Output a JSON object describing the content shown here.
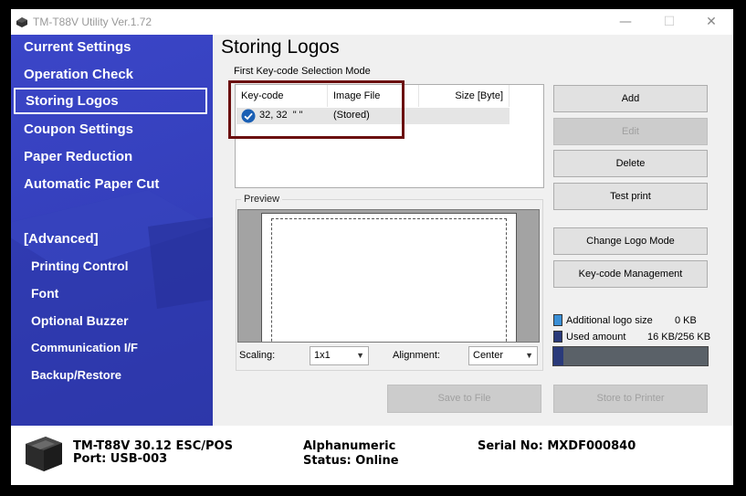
{
  "window": {
    "title": "TM-T88V Utility Ver.1.72",
    "minimize": "—",
    "maximize": "☐",
    "close": "✕"
  },
  "sidebar": {
    "items": [
      {
        "label": "Current Settings"
      },
      {
        "label": "Operation Check"
      },
      {
        "label": "Storing Logos",
        "selected": true
      },
      {
        "label": "Coupon Settings"
      },
      {
        "label": "Paper Reduction"
      },
      {
        "label": "Automatic Paper Cut"
      },
      {
        "label": "[Advanced]"
      },
      {
        "label": "Printing Control"
      },
      {
        "label": "Font"
      },
      {
        "label": "Optional Buzzer"
      },
      {
        "label": "Communication I/F"
      },
      {
        "label": "Backup/Restore"
      }
    ]
  },
  "main": {
    "title": "Storing Logos",
    "mode_label": "First Key-code Selection Mode",
    "list": {
      "columns": [
        "Key-code",
        "Image File",
        "Size [Byte]"
      ],
      "rows": [
        {
          "key_code": "32, 32  \" \"",
          "image_file": "(Stored)",
          "size": ""
        }
      ]
    },
    "preview_label": "Preview",
    "scaling_label": "Scaling:",
    "scaling_value": "1x1",
    "alignment_label": "Alignment:",
    "alignment_value": "Center",
    "buttons": {
      "add": "Add",
      "edit": "Edit",
      "delete": "Delete",
      "test_print": "Test print",
      "change_logo_mode": "Change Logo Mode",
      "keycode_management": "Key-code Management",
      "save_to_file": "Save to File",
      "store_to_printer": "Store to Printer"
    },
    "usage": {
      "additional_label": "Additional logo size",
      "additional_value": "0 KB",
      "used_label": "Used amount",
      "used_value": "16 KB/256 KB",
      "used_fraction": 0.0625,
      "colors": {
        "additional": "#3a8fd6",
        "used": "#2a3a7a"
      }
    }
  },
  "status": {
    "model": "TM-T88V 30.12 ESC/POS",
    "port": "Port: USB-003",
    "charset": "Alphanumeric",
    "status": "Status: Online",
    "serial": "Serial No: MXDF000840"
  }
}
